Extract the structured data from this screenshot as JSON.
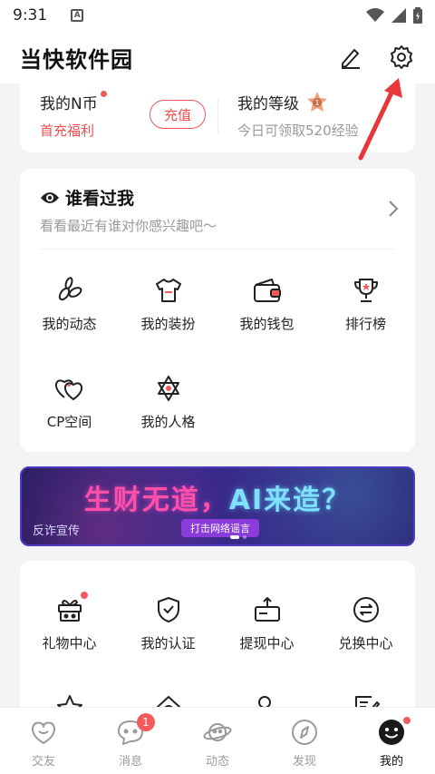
{
  "status_bar": {
    "time": "9:31",
    "indicator": "A"
  },
  "header": {
    "title": "当快软件园",
    "edit_icon": "edit-icon",
    "settings_icon": "gear-icon"
  },
  "coins": {
    "label": "我的N币",
    "sub": "首充福利",
    "recharge": "充值",
    "level_label": "我的等级",
    "level_badge": "1",
    "level_sub": "今日可领取520经验"
  },
  "visitors": {
    "title": "谁看过我",
    "subtitle": "看看最近有谁对你感兴趣吧〜"
  },
  "features": [
    {
      "label": "我的动态",
      "icon": "leaves-icon"
    },
    {
      "label": "我的装扮",
      "icon": "tshirt-icon"
    },
    {
      "label": "我的钱包",
      "icon": "wallet-icon"
    },
    {
      "label": "排行榜",
      "icon": "trophy-icon"
    },
    {
      "label": "CP空间",
      "icon": "hearts-icon"
    },
    {
      "label": "我的人格",
      "icon": "star-of-david-icon"
    }
  ],
  "banner": {
    "headline_a": "生财无道，",
    "headline_b": "AI来造？",
    "pill": "打击网络谣言",
    "tag": "反诈宣传"
  },
  "services": [
    {
      "label": "礼物中心",
      "icon": "gift-icon",
      "dot": true
    },
    {
      "label": "我的认证",
      "icon": "shield-check-icon",
      "dot": false
    },
    {
      "label": "提现中心",
      "icon": "withdraw-icon",
      "dot": false
    },
    {
      "label": "兑换中心",
      "icon": "exchange-icon",
      "dot": false
    },
    {
      "label": "",
      "icon": "star-icon",
      "dot": false
    },
    {
      "label": "",
      "icon": "home-no-icon",
      "dot": false
    },
    {
      "label": "",
      "icon": "user-star-icon",
      "dot": false
    },
    {
      "label": "",
      "icon": "note-edit-icon",
      "dot": false
    }
  ],
  "tabs": [
    {
      "label": "交友",
      "icon": "heart-bubble-icon"
    },
    {
      "label": "消息",
      "icon": "chat-bubble-icon",
      "badge": "1"
    },
    {
      "label": "动态",
      "icon": "planet-icon"
    },
    {
      "label": "发现",
      "icon": "compass-icon"
    },
    {
      "label": "我的",
      "icon": "smile-icon",
      "active": true
    }
  ],
  "colors": {
    "accent": "#f15b5b",
    "arrow": "#e8373a"
  }
}
